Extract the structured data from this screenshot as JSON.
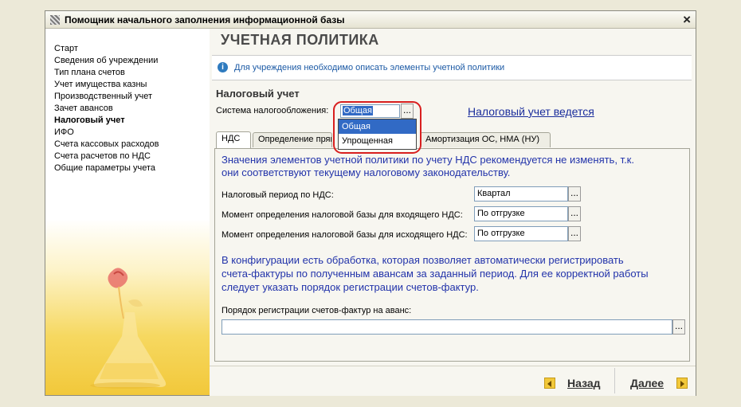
{
  "window": {
    "title": "Помощник начального заполнения информационной базы",
    "close_symbol": "×"
  },
  "sidebar": {
    "items": [
      {
        "label": "Старт",
        "active": false
      },
      {
        "label": "Сведения об учреждении",
        "active": false
      },
      {
        "label": "Тип плана счетов",
        "active": false
      },
      {
        "label": "Учет имущества казны",
        "active": false
      },
      {
        "label": "Производственный учет",
        "active": false
      },
      {
        "label": "Зачет авансов",
        "active": false
      },
      {
        "label": "Налоговый учет",
        "active": true
      },
      {
        "label": "ИФО",
        "active": false
      },
      {
        "label": "Счета кассовых расходов",
        "active": false
      },
      {
        "label": "Счета расчетов по НДС",
        "active": false
      },
      {
        "label": "Общие параметры учета",
        "active": false
      }
    ]
  },
  "main": {
    "page_title": "УЧЕТНАЯ ПОЛИТИКА",
    "info_text": "Для учреждения необходимо описать элементы учетной политики",
    "section_title": "Налоговый учет",
    "tax_system": {
      "label": "Система налогообложения:",
      "value": "Общая",
      "options": [
        "Общая",
        "Упрощенная"
      ],
      "button_label": "..."
    },
    "tax_link": "Налоговый учет ведется",
    "tabs": [
      {
        "label": "НДС",
        "active": true
      },
      {
        "label": "Определение прямых",
        "active": false
      },
      {
        "label": "Амортизация ОС, НМА (НУ)",
        "active": false
      }
    ],
    "vat_panel": {
      "note_line1": "Значения элементов учетной политики по учету НДС рекомендуется не изменять, т.к.",
      "note_line2": "они соответствуют текущему налоговому законодательству.",
      "fields": [
        {
          "label": "Налоговый период по НДС:",
          "value": "Квартал"
        },
        {
          "label": "Момент определения налоговой базы для входящего НДС:",
          "value": "По отгрузке"
        },
        {
          "label": "Момент определения налоговой базы для исходящего НДС:",
          "value": "По отгрузке"
        }
      ],
      "processing_line1": "В конфигурации есть обработка, которая позволяет автоматически регистрировать",
      "processing_line2": "счета-фактуры по полученным авансам за заданный период. Для ее корректной работы",
      "processing_line3": "следует указать порядок регистрации счетов-фактур.",
      "advance_label": "Порядок регистрации счетов-фактур на аванс:",
      "advance_value": "",
      "button_label": "..."
    }
  },
  "footer": {
    "back_label": "Назад",
    "next_label": "Далее"
  },
  "colors": {
    "accent_yellow": "#f2c83a",
    "link_blue": "#1a2d9c",
    "highlight_red": "#d81f1f",
    "selection_blue": "#316ac5"
  }
}
